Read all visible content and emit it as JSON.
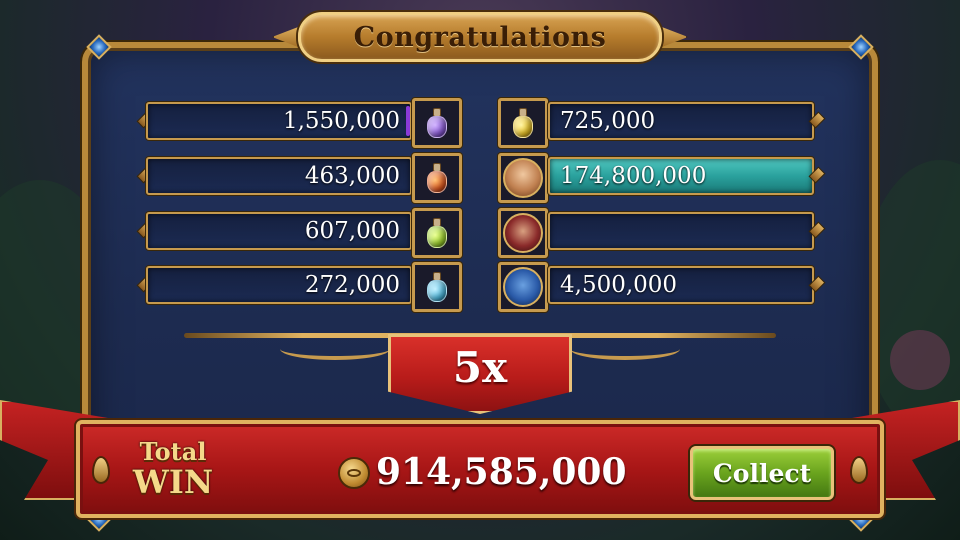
{
  "title": "Congratulations",
  "colors": {
    "accent_gold": "#c69a4e",
    "highlight_teal": "#2aa19d",
    "banner_red": "#b81c1a",
    "button_green": "#6aa41e"
  },
  "left_column": [
    {
      "value": "1,550,000",
      "icon": "purple-potion-icon",
      "color": "#8a5ad8",
      "marker": "#8a3ad8"
    },
    {
      "value": "463,000",
      "icon": "orange-potion-icon",
      "color": "#e0561e",
      "marker": ""
    },
    {
      "value": "607,000",
      "icon": "green-potion-icon",
      "color": "#9ad02a",
      "marker": ""
    },
    {
      "value": "272,000",
      "icon": "blue-potion-icon",
      "color": "#4ab8e0",
      "marker": ""
    }
  ],
  "right_column": [
    {
      "value": "725,000",
      "icon": "yellow-potion-icon",
      "color": "#e8c020",
      "highlight": false,
      "marker": ""
    },
    {
      "value": "174,800,000",
      "icon": "elf-portrait-icon",
      "color": "#d89a68",
      "highlight": true,
      "marker": ""
    },
    {
      "value": "",
      "icon": "man-portrait-icon",
      "color": "#8a2a2a",
      "highlight": false,
      "marker": ""
    },
    {
      "value": "4,500,000",
      "icon": "wolf-portrait-icon",
      "color": "#2a5aa8",
      "highlight": false,
      "marker": "#a040e0"
    }
  ],
  "multiplier": "5x",
  "total": {
    "label_line1": "Total",
    "label_line2": "WIN",
    "amount": "914,585,000",
    "icon": "coin-icon"
  },
  "collect_button": {
    "label": "Collect"
  }
}
